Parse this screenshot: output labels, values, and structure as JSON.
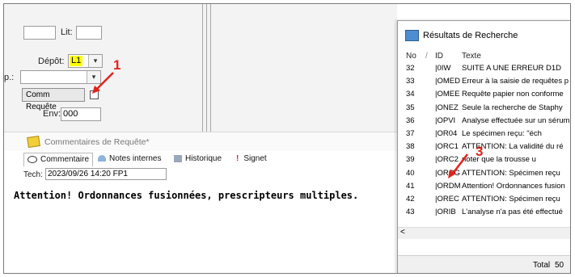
{
  "form": {
    "lit_label": "Lit:",
    "depot_label": "Dépôt:",
    "depot_value": "L1",
    "p_label": "p.:",
    "comm_requete_label": "Comm Requête",
    "env_label": "Env:",
    "env_value": "000"
  },
  "annotations": [
    "1",
    "3"
  ],
  "comments": {
    "window_title": "Commentaires de Requête*",
    "tabs": [
      "Commentaire",
      "Notes internes",
      "Historique",
      "Signet"
    ],
    "tech_label": "Tech:",
    "tech_value": "2023/09/26 14:20 FP1",
    "text": "Attention! Ordonnances fusionnées, prescripteurs multiples."
  },
  "results": {
    "title": "Résultats de Recherche",
    "columns": [
      "No",
      "ID",
      "Texte"
    ],
    "rows": [
      {
        "no": "32",
        "id": "|0IW",
        "text": "SUITE A UNE ERREUR D1D"
      },
      {
        "no": "33",
        "id": "|OMED",
        "text": "Erreur à la saisie de requêtes p"
      },
      {
        "no": "34",
        "id": "|OMEE",
        "text": "Requête papier non conforme"
      },
      {
        "no": "35",
        "id": "|ONEZ",
        "text": "Seule la recherche de Staphy"
      },
      {
        "no": "36",
        "id": "|OPVI",
        "text": "Analyse effectuée sur un sérum"
      },
      {
        "no": "37",
        "id": "|OR04",
        "text": "Le spécimen reçu: \"éch"
      },
      {
        "no": "38",
        "id": "|ORC1",
        "text": "ATTENTION: La validité du ré"
      },
      {
        "no": "39",
        "id": "|ORC2",
        "text": "noter que la trousse u"
      },
      {
        "no": "40",
        "id": "|ORCG",
        "text": "ATTENTION: Spécimen reçu"
      },
      {
        "no": "41",
        "id": "|ORDM",
        "text": "Attention! Ordonnances fusion"
      },
      {
        "no": "42",
        "id": "|OREC",
        "text": "ATTENTION: Spécimen reçu"
      },
      {
        "no": "43",
        "id": "|ORIB",
        "text": "L'analyse n'a pas été effectué"
      }
    ],
    "total_label": "Total",
    "total_value": "50"
  },
  "colors": {
    "annotation": "#e2231a",
    "depot_highlight": "#ffff00"
  }
}
